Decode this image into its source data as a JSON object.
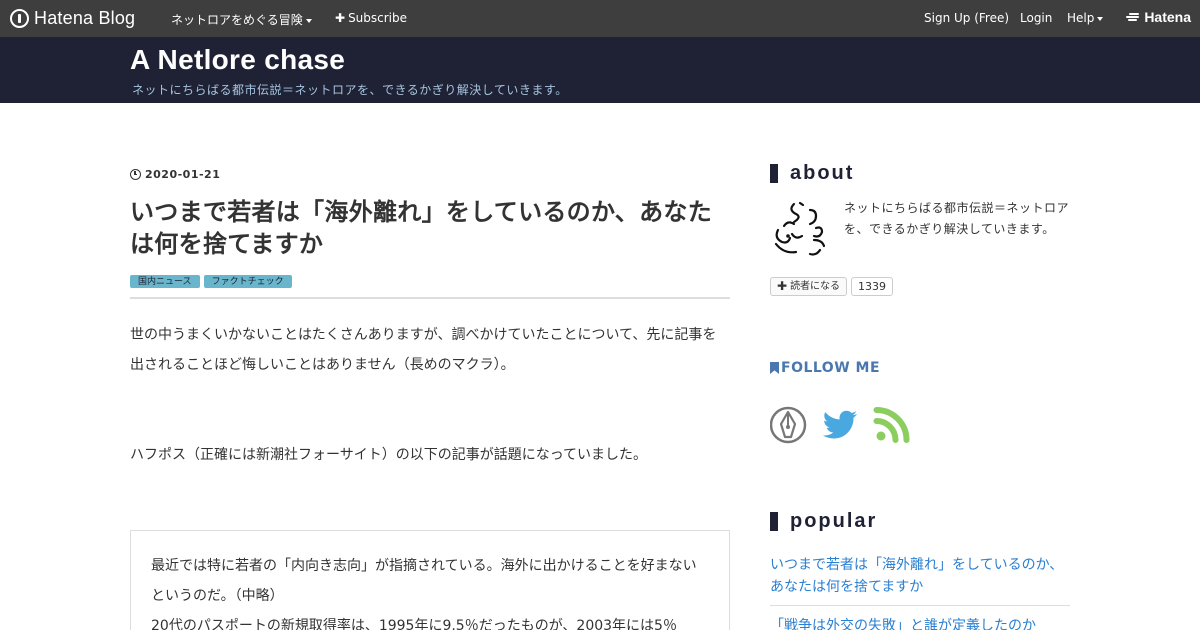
{
  "topbar": {
    "brand": "Hatena Blog",
    "blog_menu": "ネットロアをめぐる冒険",
    "subscribe": "Subscribe",
    "signup": "Sign Up (Free)",
    "login": "Login",
    "help": "Help",
    "hatena": "Hatena"
  },
  "header": {
    "title": "A Netlore chase",
    "description": "ネットにちらばる都市伝説＝ネットロアを、できるかぎり解決していきます。"
  },
  "article": {
    "date": "2020-01-21",
    "title": "いつまで若者は「海外離れ」をしているのか、あなたは何を捨てますか",
    "categories": [
      "国内ニュース",
      "ファクトチェック"
    ],
    "paragraph1": "世の中うまくいかないことはたくさんありますが、調べかけていたことについて、先に記事を出されることほど悔しいことはありません（長めのマクラ）。",
    "paragraph2": "ハフポス（正確には新潮社フォーサイト）の以下の記事が話題になっていました。",
    "quote": [
      "最近では特に若者の「内向き志向」が指摘されている。海外に出かけることを好まないというのだ。（中略）",
      "20代のパスポートの新規取得率は、1995年に9.5％だったものが、2003年には5％"
    ]
  },
  "sidebar": {
    "about_heading": "about",
    "about_text": "ネットにちらばる都市伝説＝ネットロアを、できるかぎり解決していきます。",
    "subscribe_button": "読者になる",
    "subscriber_count": "1339",
    "follow_heading": "FOLLOW ME",
    "social_icons": [
      "hatena-pen-icon",
      "twitter-icon",
      "rss-icon"
    ],
    "popular_heading": "popular",
    "popular_items": [
      "いつまで若者は「海外離れ」をしているのか、あなたは何を捨てますか",
      "「戦争は外交の失敗」と誰が定義したのか"
    ]
  },
  "colors": {
    "topbar": "#3e3e3e",
    "header": "#1f2234",
    "category_badge": "#68b5cc",
    "link": "#2a7fd1",
    "follow": "#4a78ae",
    "twitter": "#4aa8e0",
    "rss": "#8ccd5f"
  }
}
